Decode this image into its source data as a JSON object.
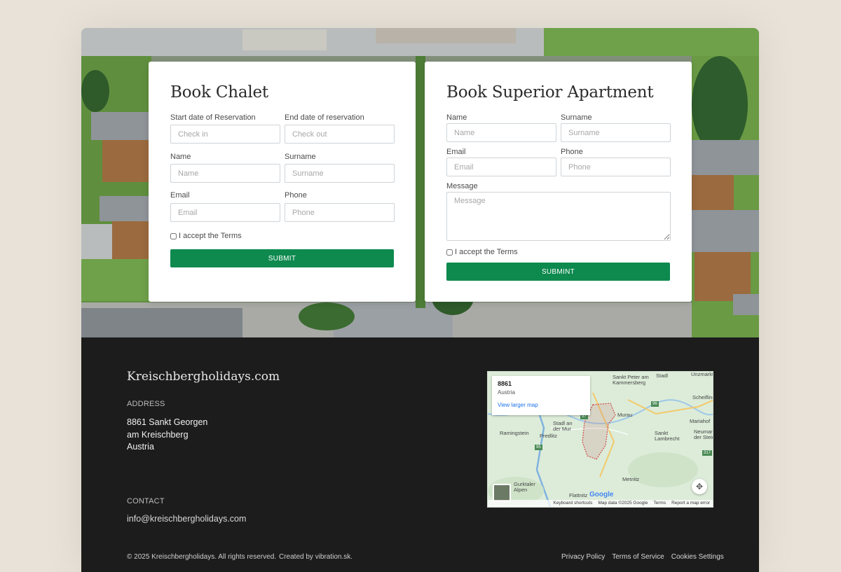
{
  "chalet_form": {
    "title": "Book Chalet",
    "start_label": "Start date of Reservation",
    "start_placeholder": "Check in",
    "end_label": "End date of reservation",
    "end_placeholder": "Check out",
    "name_label": "Name",
    "name_placeholder": "Name",
    "surname_label": "Surname",
    "surname_placeholder": "Surname",
    "email_label": "Email",
    "email_placeholder": "Email",
    "phone_label": "Phone",
    "phone_placeholder": "Phone",
    "terms_label": "I accept the Terms",
    "submit_label": "SUBMIT"
  },
  "apartment_form": {
    "title": "Book Superior Apartment",
    "name_label": "Name",
    "name_placeholder": "Name",
    "surname_label": "Surname",
    "surname_placeholder": "Surname",
    "email_label": "Email",
    "email_placeholder": "Email",
    "phone_label": "Phone",
    "phone_placeholder": "Phone",
    "message_label": "Message",
    "message_placeholder": "Message",
    "terms_label": "I accept the Terms",
    "submit_label": "SUBMINT"
  },
  "footer": {
    "brand": "Kreischbergholidays.com",
    "address_heading": "ADDRESS",
    "address_line1": "8861 Sankt Georgen",
    "address_line2": "am Kreischberg",
    "address_line3": "Austria",
    "contact_heading": "CONTACT",
    "contact_email": "info@kreischbergholidays.com",
    "copyright": "© 2025 Kreischbergholidays. All rights reserved.",
    "credit": "Created by vibration.sk.",
    "links": [
      "Privacy Policy",
      "Terms of Service",
      "Cookies Settings"
    ]
  },
  "map": {
    "info_title": "8861",
    "info_subtitle": "Austria",
    "info_link": "View larger map",
    "labels": {
      "sankt_peter": "Sankt Peter am\nKammersberg",
      "stadl": "Stadl",
      "unzmarkt": "Unzmarkt",
      "scheifling": "Scheifling",
      "murau": "Murau",
      "ramingstein": "Ramingstein",
      "stadl_mur": "Stadl an\nder Mur",
      "predlitz": "Predlitz",
      "mariahof": "Mariahof",
      "neumarkt": "Neumarkt\nder Steier",
      "sankt_lambrecht": "Sankt\nLambrecht",
      "metnitz": "Metnitz",
      "gurktaler": "Gurktaler\nAlpen",
      "flattnitz": "Flattnitz",
      "r96": "96",
      "r97": "97",
      "r95": "95",
      "r317": "317"
    },
    "google": "Google",
    "attribution": [
      "Keyboard shortcuts",
      "Map data ©2025 Google",
      "Terms",
      "Report a map error"
    ]
  },
  "colors": {
    "accent": "#0e8a4f",
    "footer_bg": "#1c1c1c",
    "page_bg": "#e8e2d8"
  }
}
